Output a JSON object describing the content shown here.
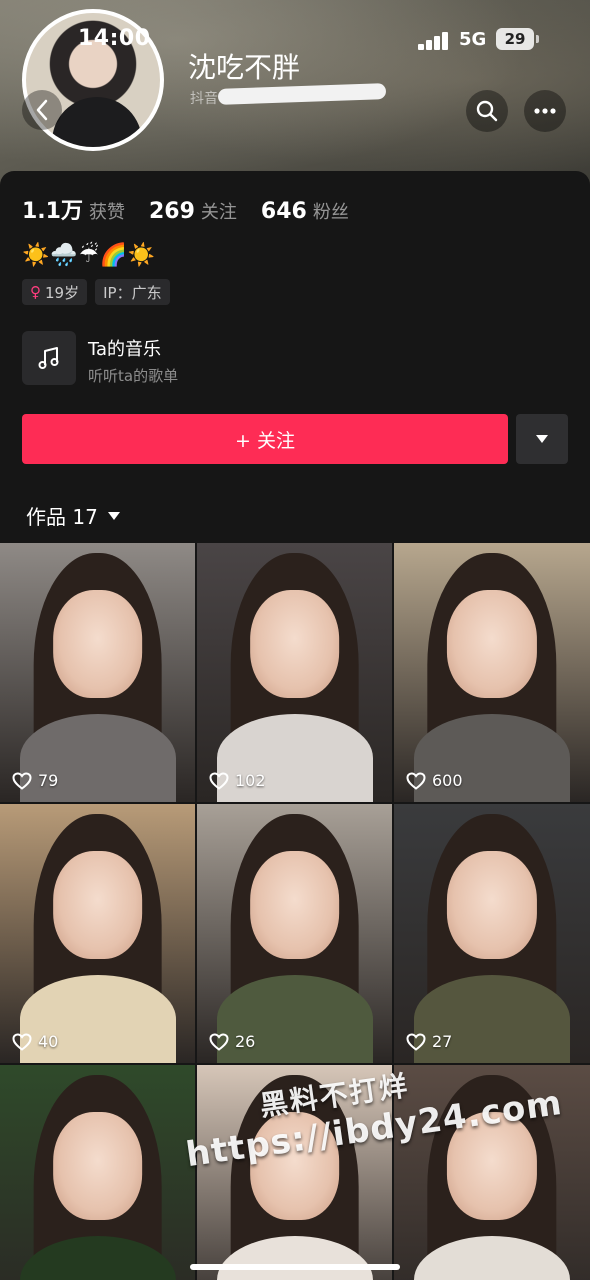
{
  "status_bar": {
    "time": "14:00",
    "network": "5G",
    "battery": "29"
  },
  "profile": {
    "name": "沈吃不胖",
    "handle_prefix": "抖音",
    "stats": [
      {
        "value": "1.1万",
        "label": "获赞"
      },
      {
        "value": "269",
        "label": "关注"
      },
      {
        "value": "646",
        "label": "粉丝"
      }
    ],
    "bio_emoji": "☀️🌧️☔🌈☀️",
    "tags": [
      {
        "icon": "female-icon",
        "text": "19岁"
      },
      {
        "icon": "",
        "text": "IP：广东"
      }
    ]
  },
  "music": {
    "title": "Ta的音乐",
    "subtitle": "听听ta的歌单"
  },
  "actions": {
    "follow_label": "+ 关注"
  },
  "works_tab": {
    "label": "作品 17"
  },
  "videos": [
    {
      "likes": "79",
      "tone": "#8f8a86",
      "shirt": "#6f6b6a"
    },
    {
      "likes": "102",
      "tone": "#4a4546",
      "shirt": "#d9d4d0"
    },
    {
      "likes": "600",
      "tone": "#b7a78e",
      "shirt": "#5d5a57"
    },
    {
      "likes": "40",
      "tone": "#b89b78",
      "shirt": "#e2d3b4"
    },
    {
      "likes": "26",
      "tone": "#a8a097",
      "shirt": "#4f5a3e"
    },
    {
      "likes": "27",
      "tone": "#3a3b3d",
      "shirt": "#55563e"
    },
    {
      "likes": "",
      "tone": "#2f4a2a",
      "shirt": "#243a20"
    },
    {
      "likes": "",
      "tone": "#d6c6b8",
      "shirt": "#e8e1da"
    },
    {
      "likes": "",
      "tone": "#5b4c44",
      "shirt": "#e3ddd6"
    }
  ],
  "watermark": {
    "line1": "黑料不打烊",
    "line2": "https://ibdy24.com"
  },
  "colors": {
    "follow": "#fe2c55",
    "panel": "#161616"
  }
}
